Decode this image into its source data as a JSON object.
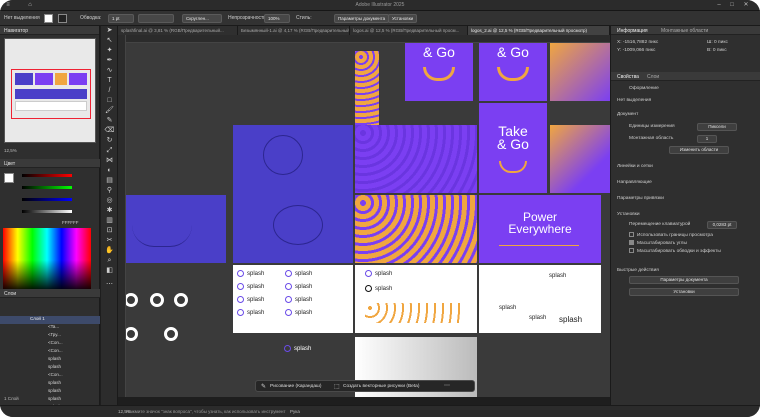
{
  "window": {
    "title": "Adobe Illustrator 2025"
  },
  "options_bar": {
    "no_selection": "Нет выделения",
    "stroke_label": "Обводка:",
    "stroke_weight": "1 pt",
    "brush": "Скруглен...",
    "opacity_label": "Непрозрачность:",
    "opacity_value": "100%",
    "style_label": "Стиль:",
    "doc_setup_button": "Параметры документа",
    "prefs_button": "Установки"
  },
  "tabs": [
    {
      "label": "splashfinal.ai @ 3,81 % (RGB/Предварительный...",
      "active": false
    },
    {
      "label": "Безымянный-1.ai @ 4,17 % (RGB/Предварительный...",
      "active": false
    },
    {
      "label": "logos.ai @ 12,5 % (RGB/Предварительный просм...",
      "active": false
    },
    {
      "label": "logos_2.ai @ 12,5 % (RGB/Предварительный просмотр)",
      "active": true
    }
  ],
  "navigator": {
    "title": "Навигатор",
    "zoom": "12,5%"
  },
  "color_panel": {
    "title": "Цвет",
    "hex": "FFFFFF"
  },
  "layers_panel": {
    "title": "Слои",
    "items": [
      "Слой 1",
      "<Ta...",
      "<Гру...",
      "<Con...",
      "<Con...",
      "splash",
      "splash",
      "<Con...",
      "splash",
      "splash",
      "splash",
      "splash"
    ],
    "count": "1 Слой"
  },
  "right_panel": {
    "tab_info": "Информация",
    "tab_artboards": "Монтажные области",
    "x": "X: -1516,7882 пикс",
    "y": "Y: -1009,066 пикс",
    "w": "Ш: 0 пикс",
    "h": "В: 0 пикс",
    "tab_properties": "Свойства",
    "tab_layers": "Слои",
    "tab_appearance": "Оформление",
    "no_selection": "Нет выделения",
    "document": "Документ",
    "units_label": "Единицы измерения",
    "units_value": "Пиксели",
    "artboard_label": "Монтажная область",
    "artboard_value": "1",
    "edit_artboards": "Изменить области",
    "rulers_grids": "Линейки и сетки",
    "guides": "Направляющие",
    "snap": "Параметры привязки",
    "preferences": "Установки",
    "keyboard_increment": "Перемещение клавиатурой",
    "increment_value": "0,0283 pt",
    "check_preview_bounds": "Использовать границы просмотра",
    "check_scale_corners": "Масштабировать углы",
    "check_scale_strokes": "Масштабировать обводки и эффекты",
    "quick_actions": "Быстрые действия",
    "quick_doc_setup": "Параметры документа",
    "quick_prefs": "Установки"
  },
  "artboards": {
    "take_go": "Take\n& Go",
    "and_go": "& Go",
    "power": "Power\nEverywhere",
    "splash": "splash"
  },
  "context_bar": {
    "draw": "Рисование (Карандаш)",
    "vectorize": "Создать векторные рисунки (Beta)"
  },
  "status": {
    "zoom": "12,5%",
    "hint": "Нажмите значок \"знак вопроса\", чтобы узнать, как использовать инструмент",
    "tool": "Рука"
  },
  "colors": {
    "purple": "#7b3ff2",
    "indigo": "#4a3fc8",
    "orange": "#f0a640",
    "canvas": "#3a3a3a"
  }
}
